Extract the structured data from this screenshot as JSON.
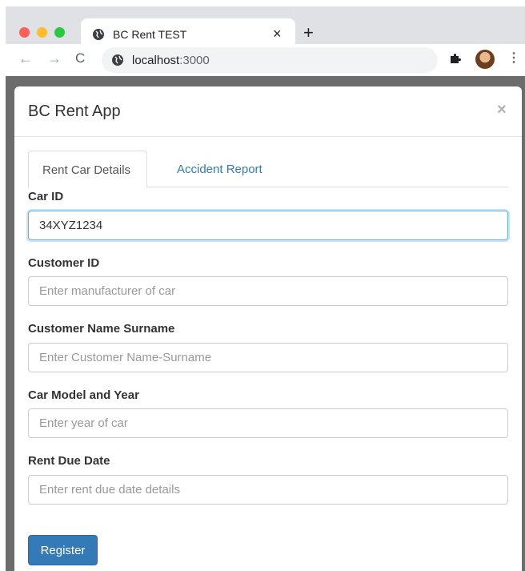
{
  "browser": {
    "tab_title": "BC Rent TEST",
    "tab_close": "×",
    "new_tab": "+",
    "url_host": "localhost",
    "url_port": ":3000",
    "back": "←",
    "forward": "→",
    "reload": "C",
    "menu": "⋮"
  },
  "modal": {
    "title": "BC Rent App",
    "close": "×"
  },
  "tabs": [
    {
      "label": "Rent Car Details",
      "active": true
    },
    {
      "label": "Accident Report",
      "active": false
    }
  ],
  "form": {
    "car_id": {
      "label": "Car ID",
      "value": "34XYZ1234"
    },
    "customer_id": {
      "label": "Customer ID",
      "placeholder": "Enter manufacturer of car"
    },
    "customer_name": {
      "label": "Customer Name Surname",
      "placeholder": "Enter Customer Name-Surname"
    },
    "car_model": {
      "label": "Car Model and Year",
      "placeholder": "Enter year of car"
    },
    "rent_due": {
      "label": "Rent Due Date",
      "placeholder": "Enter rent due date details"
    },
    "submit_label": "Register"
  },
  "colors": {
    "primary": "#337ab7",
    "link": "#337ab7",
    "focus_border": "#66afe9",
    "backdrop": "#6c6c6c"
  }
}
